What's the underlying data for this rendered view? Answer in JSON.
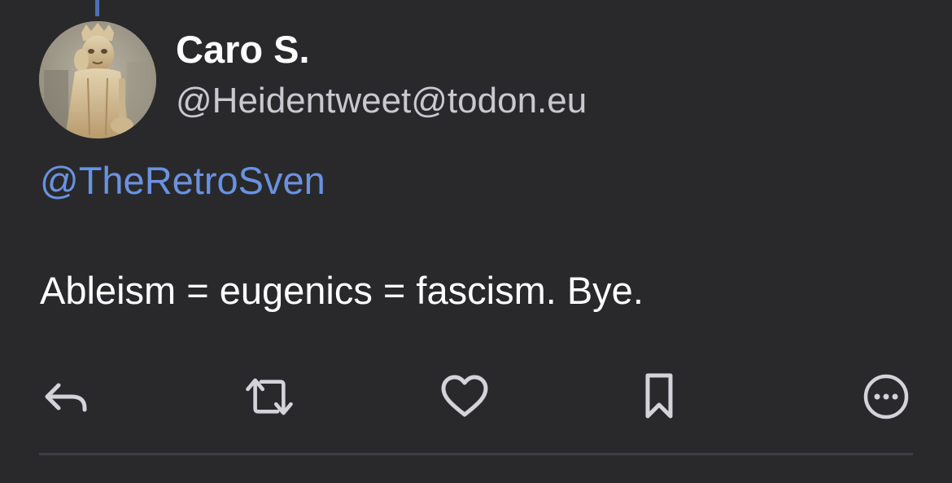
{
  "post": {
    "author_name": "Caro S.",
    "author_handle": "@Heidentweet@todon.eu",
    "mention": "@TheRetroSven",
    "text": "Ableism = eugenics = fascism. Bye."
  },
  "actions": [
    {
      "name": "reply",
      "icon": "reply-icon"
    },
    {
      "name": "boost",
      "icon": "boost-icon"
    },
    {
      "name": "favourite",
      "icon": "heart-icon"
    },
    {
      "name": "bookmark",
      "icon": "bookmark-icon"
    },
    {
      "name": "more",
      "icon": "more-icon"
    }
  ],
  "colors": {
    "background": "#29292b",
    "mention": "#6a92e0",
    "thread_line": "#4c6fb8",
    "handle": "#c9c9ce",
    "icon": "#d4d4d8"
  }
}
